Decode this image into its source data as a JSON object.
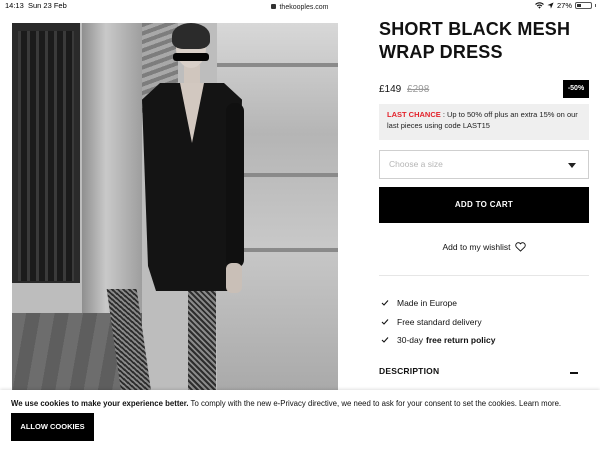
{
  "status_bar": {
    "time": "14:13",
    "date": "Sun 23 Feb",
    "url": "thekooples.com",
    "battery": "27%"
  },
  "product": {
    "title": "SHORT BLACK MESH WRAP DRESS",
    "price": "£149",
    "old_price": "£298",
    "discount": "-50%",
    "promo_label": "LAST CHANCE",
    "promo_text": " : Up to 50% off plus an extra 15% on our last pieces using code LAST15",
    "size_placeholder": "Choose a size",
    "add_to_cart": "ADD TO CART",
    "wishlist": "Add to my wishlist",
    "features": [
      {
        "text": "Made in Europe",
        "bold": ""
      },
      {
        "text": "Free standard delivery",
        "bold": ""
      },
      {
        "text": "30-day",
        "bold": "free return policy"
      }
    ],
    "description_label": "DESCRIPTION"
  },
  "cookie_banner": {
    "bold_text": "We use cookies to make your experience better.",
    "text": " To comply with the new e-Privacy directive, we need to ask for your consent to set the cookies. Learn more.",
    "allow_label": "ALLOW COOKIES"
  },
  "colors": {
    "accent_red": "#e3222b",
    "button_black": "#000000",
    "promo_bg": "#efefef"
  },
  "icons": [
    "lock-icon",
    "wifi-icon",
    "battery-icon",
    "chevron-down-icon",
    "heart-icon",
    "check-icon",
    "minus-icon"
  ]
}
